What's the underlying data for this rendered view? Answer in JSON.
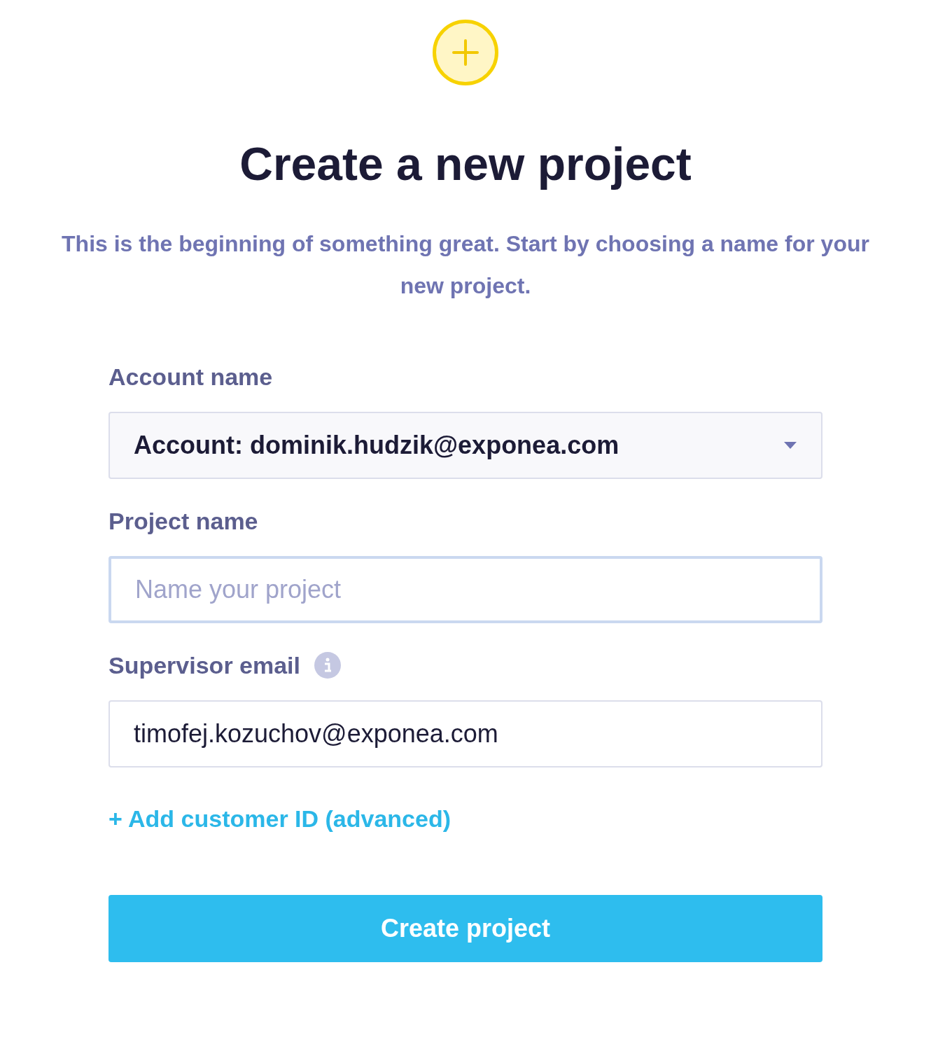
{
  "title": "Create a new project",
  "subtitle": "This is the beginning of something great. Start by choosing a name for your new project.",
  "fields": [
    {
      "kind": "select",
      "label": "Account name",
      "value": "Account: dominik.hudzik@exponea.com",
      "focused": false,
      "info": false
    },
    {
      "kind": "input",
      "label": "Project name",
      "placeholder": "Name your project",
      "focused": true,
      "info": false
    },
    {
      "kind": "input",
      "label": "Supervisor email",
      "value": "timofej.kozuchov@exponea.com",
      "focused": false,
      "info": true
    }
  ],
  "link": "+ Add customer ID (advanced)",
  "button": "Create project"
}
